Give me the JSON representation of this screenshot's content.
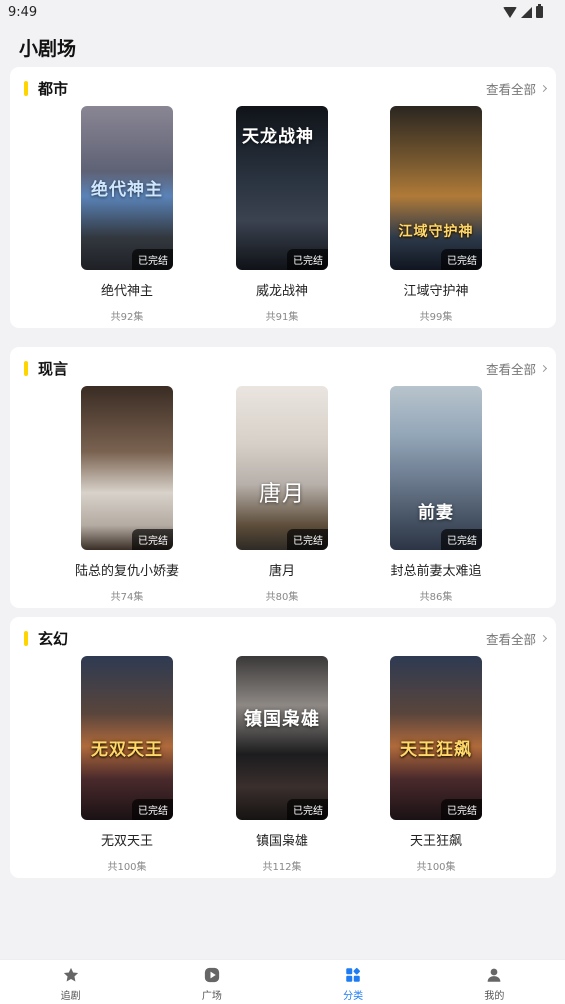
{
  "status_bar": {
    "time": "9:49"
  },
  "page": {
    "title": "小剧场"
  },
  "sections": [
    {
      "title": "都市",
      "more_label": "查看全部",
      "items": [
        {
          "title": "绝代神主",
          "count": "共92集",
          "badge": "已完结",
          "poster_text": "绝代神主"
        },
        {
          "title": "威龙战神",
          "count": "共91集",
          "badge": "已完结",
          "poster_text": "天龙战神"
        },
        {
          "title": "江域守护神",
          "count": "共99集",
          "badge": "已完结",
          "poster_text": "江域守护神"
        }
      ]
    },
    {
      "title": "现言",
      "more_label": "查看全部",
      "items": [
        {
          "title": "陆总的复仇小娇妻",
          "count": "共74集",
          "badge": "已完结",
          "poster_text": ""
        },
        {
          "title": "唐月",
          "count": "共80集",
          "badge": "已完结",
          "poster_text": "唐月"
        },
        {
          "title": "封总前妻太难追",
          "count": "共86集",
          "badge": "已完结",
          "poster_text": "前妻"
        }
      ]
    },
    {
      "title": "玄幻",
      "more_label": "查看全部",
      "items": [
        {
          "title": "无双天王",
          "count": "共100集",
          "badge": "已完结",
          "poster_text": "无双天王"
        },
        {
          "title": "镇国枭雄",
          "count": "共112集",
          "badge": "已完结",
          "poster_text": "镇国枭雄"
        },
        {
          "title": "天王狂飙",
          "count": "共100集",
          "badge": "已完结",
          "poster_text": "天王狂飙"
        }
      ]
    }
  ],
  "tabbar": [
    {
      "label": "追剧",
      "icon": "star-icon",
      "active": false
    },
    {
      "label": "广场",
      "icon": "play-icon",
      "active": false
    },
    {
      "label": "分类",
      "icon": "category-icon",
      "active": true
    },
    {
      "label": "我的",
      "icon": "user-icon",
      "active": false
    }
  ],
  "colors": {
    "accent": "#1d7cf2",
    "section_bar": "#ffd500"
  }
}
